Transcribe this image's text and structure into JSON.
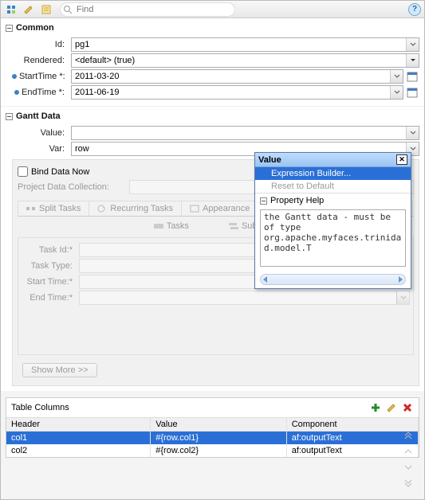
{
  "toolbar": {
    "find_placeholder": "Find",
    "help_label": "?"
  },
  "sections": {
    "common": {
      "title": "Common"
    },
    "gantt": {
      "title": "Gantt Data"
    }
  },
  "common": {
    "id_label": "Id:",
    "id_value": "pg1",
    "rendered_label": "Rendered:",
    "rendered_value": "<default> (true)",
    "start_label": "StartTime *:",
    "start_value": "2011-03-20",
    "end_label": "EndTime *:",
    "end_value": "2011-06-19"
  },
  "gantt": {
    "value_label": "Value:",
    "value_value": "",
    "var_label": "Var:",
    "var_value": "row",
    "bind_now_label": "Bind Data Now",
    "proj_label": "Project Data Collection:",
    "tabs": {
      "split": "Split Tasks",
      "recurring": "Recurring Tasks",
      "appearance": "Appearance"
    },
    "subtabs": {
      "tasks": "Tasks",
      "subtasks": "Subtasks"
    },
    "task_form": {
      "task_id": "Task Id:*",
      "task_type": "Task Type:",
      "start_time": "Start Time:*",
      "end_time": "End Time:*"
    },
    "show_more": "Show More >>"
  },
  "table": {
    "title": "Table Columns",
    "headers": [
      "Header",
      "Value",
      "Component"
    ],
    "rows": [
      {
        "header": "col1",
        "value": "#{row.col1}",
        "component": "af:outputText"
      },
      {
        "header": "col2",
        "value": "#{row.col2}",
        "component": "af:outputText"
      }
    ]
  },
  "popup": {
    "title": "Value",
    "item_builder": "Expression Builder...",
    "item_reset": "Reset to Default",
    "help_title": "Property Help",
    "help_text": "the Gantt data - must be of type org.apache.myfaces.trinidad.model.T"
  }
}
